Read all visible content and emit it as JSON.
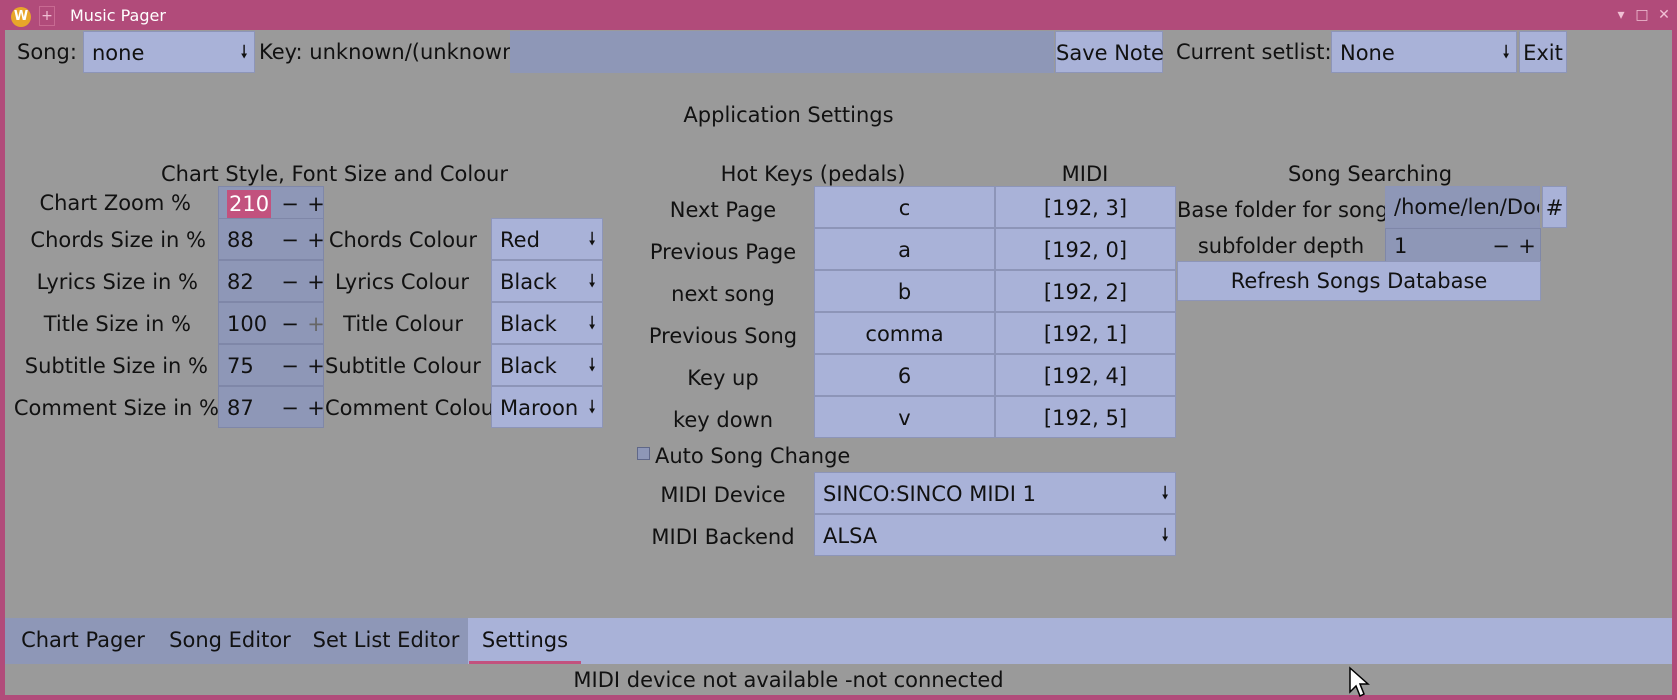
{
  "window": {
    "title": "Music Pager",
    "app_icon": "W"
  },
  "toolbar": {
    "song_label": "Song:",
    "song_value": "none",
    "key_text": "Key: unknown/(unknown)",
    "save_note": "Save Note",
    "setlist_label": "Current setlist:",
    "setlist_value": "None",
    "exit": "Exit"
  },
  "settings": {
    "heading": "Application Settings",
    "chart": {
      "heading": "Chart Style, Font Size and Colour",
      "rows": [
        {
          "label": "Chart Zoom %",
          "value": "210"
        },
        {
          "label": "Chords Size in %",
          "value": "88",
          "colour_label": "Chords Colour",
          "colour": "Red"
        },
        {
          "label": "Lyrics Size in %",
          "value": "82",
          "colour_label": "Lyrics Colour",
          "colour": "Black"
        },
        {
          "label": "Title Size in %",
          "value": "100",
          "colour_label": "Title Colour",
          "colour": "Black"
        },
        {
          "label": "Subtitle Size in %",
          "value": "75",
          "colour_label": "Subtitle Colour",
          "colour": "Black"
        },
        {
          "label": "Comment Size in %",
          "value": "87",
          "colour_label": "Comment Colour",
          "colour": "Maroon"
        }
      ]
    },
    "hotkeys": {
      "heading": "Hot Keys (pedals)",
      "midi_heading": "MIDI",
      "rows": [
        {
          "label": "Next Page",
          "key": "c",
          "midi": "[192, 3]"
        },
        {
          "label": "Previous Page",
          "key": "a",
          "midi": "[192, 0]"
        },
        {
          "label": "next song",
          "key": "b",
          "midi": "[192, 2]"
        },
        {
          "label": "Previous Song",
          "key": "comma",
          "midi": "[192, 1]"
        },
        {
          "label": "Key up",
          "key": "6",
          "midi": "[192, 4]"
        },
        {
          "label": "key down",
          "key": "v",
          "midi": "[192, 5]"
        }
      ],
      "auto_song_change": "Auto Song Change",
      "midi_device_label": "MIDI Device",
      "midi_device_value": "SINCO:SINCO MIDI 1",
      "midi_backend_label": "MIDI Backend",
      "midi_backend_value": "ALSA"
    },
    "search": {
      "heading": "Song Searching",
      "base_folder_label": "Base folder for songs",
      "base_folder_value": "/home/len/Documents/Songs",
      "browse_button": "#",
      "depth_label": "subfolder depth",
      "depth_value": "1",
      "refresh_button": "Refresh Songs Database"
    }
  },
  "tabs": [
    "Chart Pager",
    "Song Editor",
    "Set List Editor",
    "Settings"
  ],
  "active_tab": "Settings",
  "status": "MIDI device not available -not connected",
  "colors": {
    "frame": "#b14b7a",
    "background": "#9a9a9a",
    "field": "#a9b2d8",
    "spin": "#8e97b7",
    "selection": "#c2527e"
  },
  "icons": [
    "app-logo-icon",
    "chevron-down-icon",
    "minus-icon",
    "plus-icon",
    "window-minimize-icon",
    "window-maximize-icon",
    "window-close-icon",
    "mouse-cursor-icon"
  ]
}
